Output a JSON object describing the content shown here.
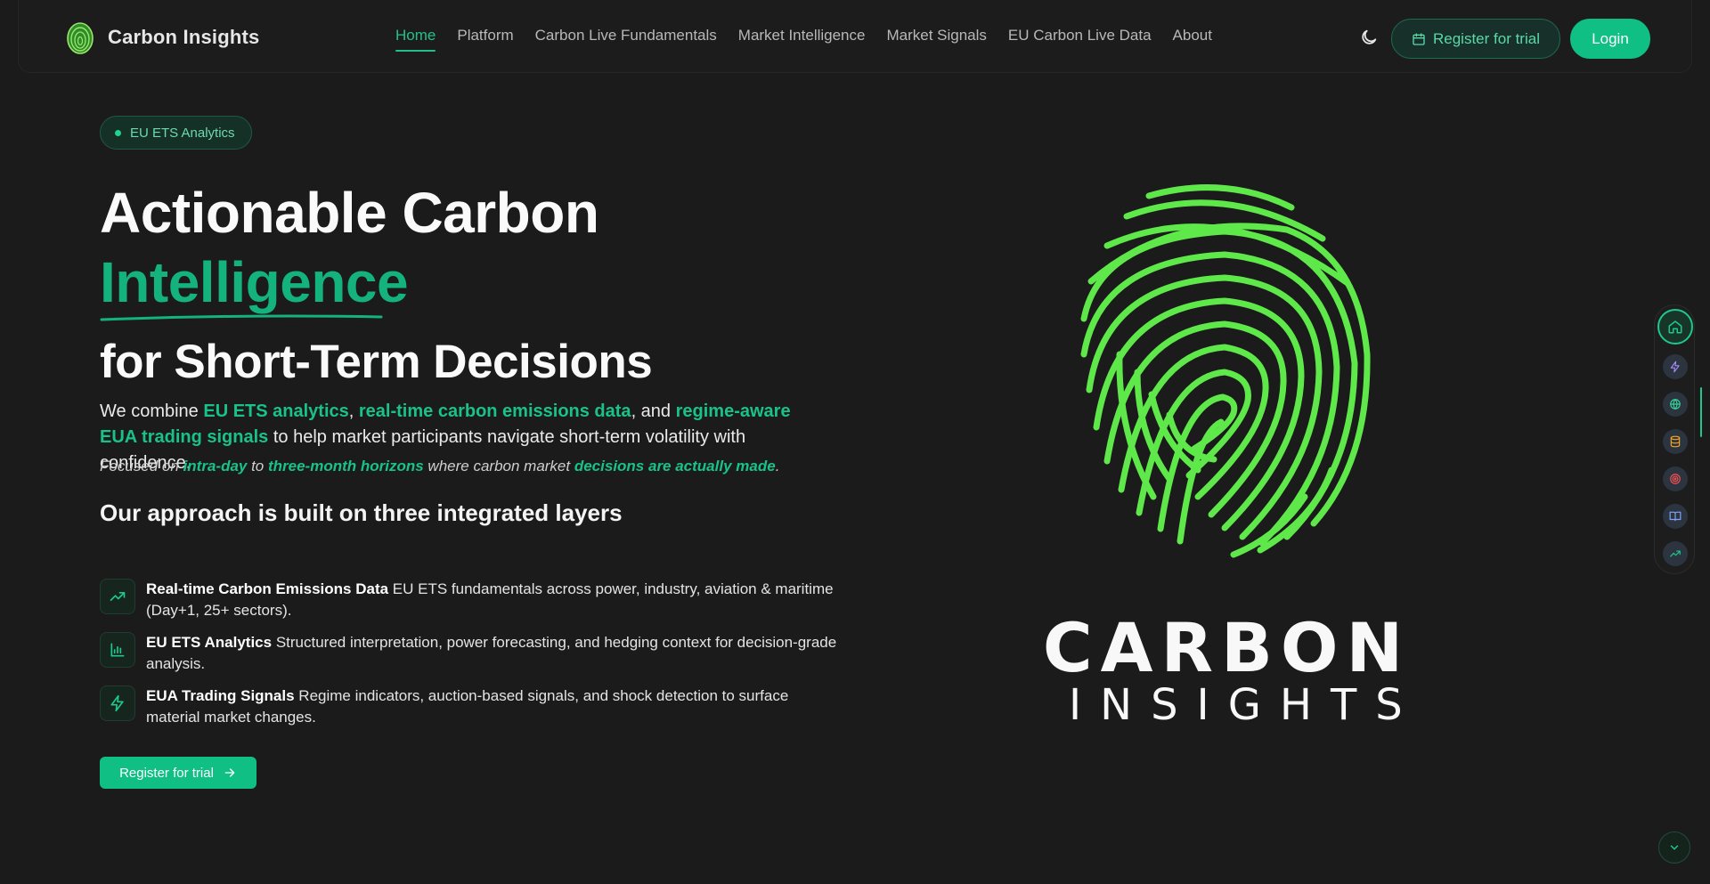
{
  "brand": {
    "name": "Carbon Insights"
  },
  "nav": {
    "links": [
      {
        "label": "Home",
        "active": true
      },
      {
        "label": "Platform"
      },
      {
        "label": "Carbon Live Fundamentals"
      },
      {
        "label": "Market Intelligence"
      },
      {
        "label": "Market Signals"
      },
      {
        "label": "EU Carbon Live Data"
      },
      {
        "label": "About"
      }
    ],
    "theme_icon": "moon-icon",
    "register_label": "Register for trial",
    "login_label": "Login"
  },
  "hero": {
    "badge": "EU ETS Analytics",
    "headline_line1": "Actionable Carbon",
    "headline_line2": "Intelligence",
    "headline_line3": "for Short-Term Decisions",
    "lead": {
      "p1": "We combine ",
      "h1": "EU ETS analytics",
      "p2": ", ",
      "h2": "real-time carbon emissions data",
      "p3": ", and ",
      "h3": "regime-aware EUA trading signals",
      "p4": " to help market participants navigate short-term volatility with confidence."
    },
    "sub": {
      "p1": "Focused on ",
      "h1": "intra-day",
      "p2": " to ",
      "h2": "three-month horizons",
      "p3": " where carbon market ",
      "h3": "decisions are actually made",
      "p4": "."
    },
    "approach_title": "Our approach is built on three integrated layers",
    "features": [
      {
        "icon": "trending-up-icon",
        "title": "Real-time Carbon Emissions Data",
        "desc": " EU ETS fundamentals across power, industry, aviation & maritime (Day+1, 25+ sectors)."
      },
      {
        "icon": "bar-chart-icon",
        "title": "EU ETS Analytics",
        "desc": " Structured interpretation, power forecasting, and hedging context for decision-grade analysis."
      },
      {
        "icon": "lightning-icon",
        "title": "EUA Trading Signals",
        "desc": " Regime indicators, auction-based signals, and shock detection to surface material market changes."
      }
    ],
    "cta_label": "Register for trial"
  },
  "visual": {
    "logo_word1": "CARBON",
    "logo_word2": "INSIGHTS"
  },
  "rail": {
    "items": [
      "home-icon",
      "lightning-icon",
      "globe-icon",
      "database-icon",
      "target-icon",
      "book-icon",
      "trending-up-icon"
    ]
  },
  "colors": {
    "accent": "#0fbf83",
    "accent_text": "#19c289",
    "background": "#1b1b1b",
    "fingerprint": "#5fe84a"
  }
}
